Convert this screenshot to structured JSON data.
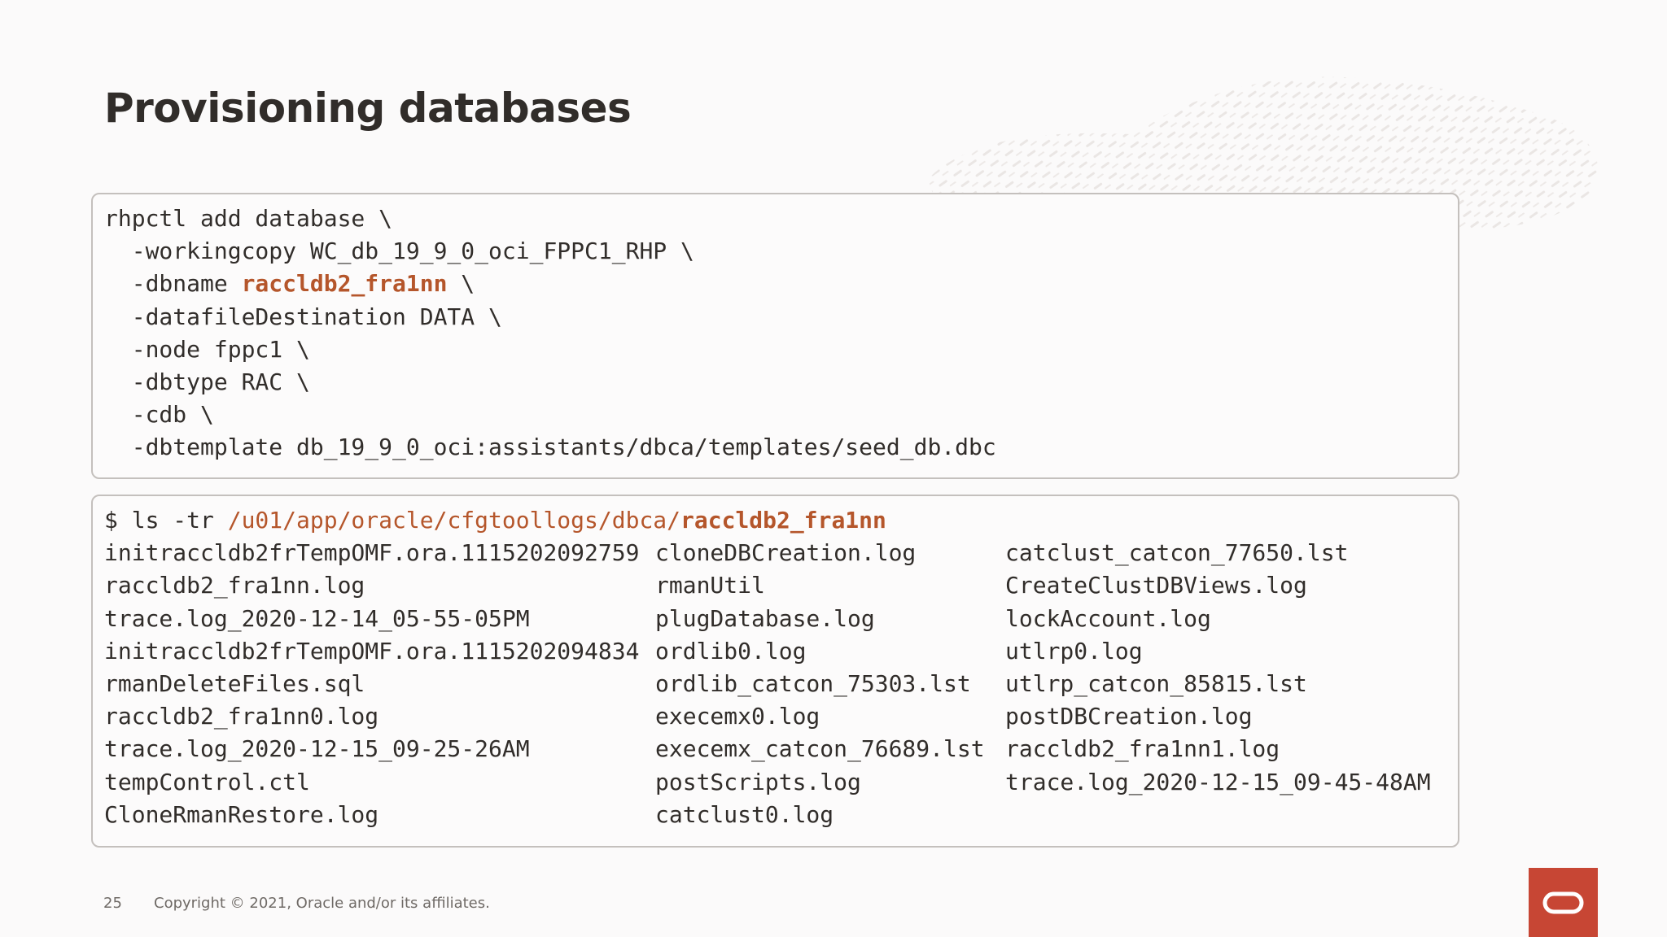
{
  "slide": {
    "title": "Provisioning databases",
    "page_number": "25",
    "copyright": "Copyright © 2021, Oracle and/or its affiliates."
  },
  "command_block": {
    "lines": [
      {
        "text": "rhpctl add database \\"
      },
      {
        "text": "  -workingcopy WC_db_19_9_0_oci_FPPC1_RHP \\"
      },
      {
        "prefix": "  -dbname ",
        "highlight": "raccldb2_fra1nn",
        "suffix": " \\"
      },
      {
        "text": "  -datafileDestination DATA \\"
      },
      {
        "text": "  -node fppc1 \\"
      },
      {
        "text": "  -dbtype RAC \\"
      },
      {
        "text": "  -cdb \\"
      },
      {
        "text": "  -dbtemplate db_19_9_0_oci:assistants/dbca/templates/seed_db.dbc"
      }
    ]
  },
  "listing_block": {
    "prompt": "$ ls -tr ",
    "path": "/u01/app/oracle/cfgtoollogs/dbca/",
    "path_highlight": "raccldb2_fra1nn",
    "files": [
      [
        "initraccldb2frTempOMF.ora.1115202092759",
        "cloneDBCreation.log",
        "catclust_catcon_77650.lst"
      ],
      [
        "raccldb2_fra1nn.log",
        "rmanUtil",
        "CreateClustDBViews.log"
      ],
      [
        "trace.log_2020-12-14_05-55-05PM",
        "plugDatabase.log",
        "lockAccount.log"
      ],
      [
        "initraccldb2frTempOMF.ora.1115202094834",
        "ordlib0.log",
        "utlrp0.log"
      ],
      [
        "rmanDeleteFiles.sql",
        "ordlib_catcon_75303.lst",
        "utlrp_catcon_85815.lst"
      ],
      [
        "raccldb2_fra1nn0.log",
        "execemx0.log",
        "postDBCreation.log"
      ],
      [
        "trace.log_2020-12-15_09-25-26AM",
        "execemx_catcon_76689.lst",
        "raccldb2_fra1nn1.log"
      ],
      [
        "tempControl.ctl",
        "postScripts.log",
        "trace.log_2020-12-15_09-45-48AM"
      ],
      [
        "CloneRmanRestore.log",
        "catclust0.log",
        ""
      ]
    ]
  },
  "colors": {
    "title": "#312d2a",
    "code_text": "#312d2a",
    "highlight": "#b5562b",
    "box_border": "#c4c0bd",
    "logo_red": "#c74634"
  },
  "icons": {
    "logo": "oracle-logo-icon",
    "background": "decorative-texture"
  }
}
